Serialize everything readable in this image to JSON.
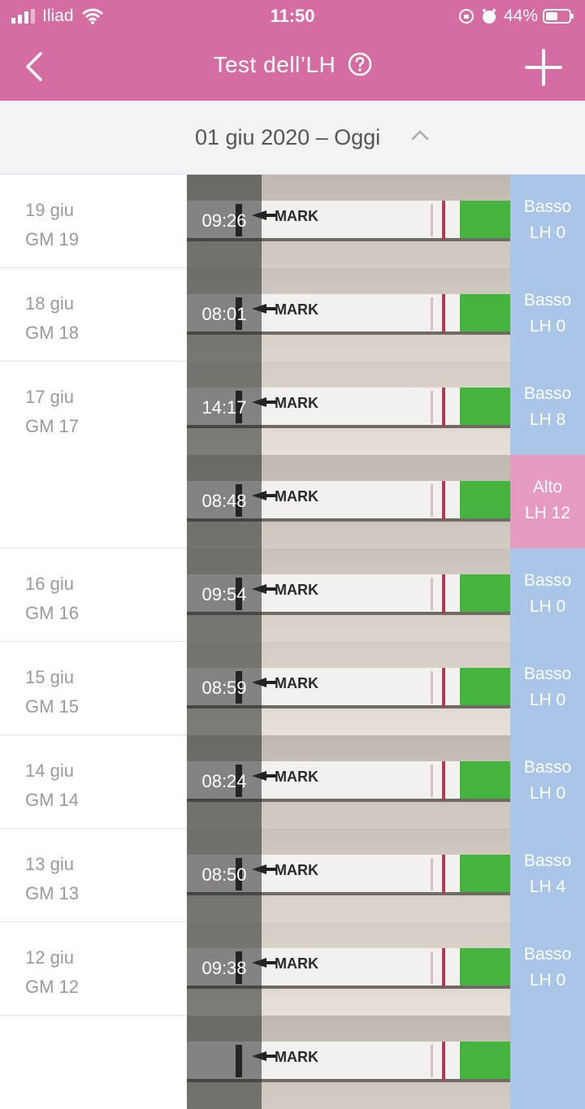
{
  "status_bar": {
    "carrier": "Iliad",
    "time": "11:50",
    "battery": "44%"
  },
  "header": {
    "title": "Test dell’LH"
  },
  "range": {
    "label": "01 giu 2020 – Oggi"
  },
  "colors": {
    "brand": "#d66da2",
    "basso": "#a9c6e9",
    "alto": "#e79ac2"
  },
  "rows": [
    {
      "date": "19 giu",
      "cycle_day": "GM 19",
      "time": "09:26",
      "level": "Basso",
      "lh": "LH 0"
    },
    {
      "date": "18 giu",
      "cycle_day": "GM 18",
      "time": "08:01",
      "level": "Basso",
      "lh": "LH 0"
    },
    {
      "date": "17 giu",
      "cycle_day": "GM 17",
      "time": "14:17",
      "level": "Basso",
      "lh": "LH 8"
    },
    {
      "date": "",
      "cycle_day": "",
      "time": "08:48",
      "level": "Alto",
      "lh": "LH 12"
    },
    {
      "date": "16 giu",
      "cycle_day": "GM 16",
      "time": "09:54",
      "level": "Basso",
      "lh": "LH 0"
    },
    {
      "date": "15 giu",
      "cycle_day": "GM 15",
      "time": "08:59",
      "level": "Basso",
      "lh": "LH 0"
    },
    {
      "date": "14 giu",
      "cycle_day": "GM 14",
      "time": "08:24",
      "level": "Basso",
      "lh": "LH 0"
    },
    {
      "date": "13 giu",
      "cycle_day": "GM 13",
      "time": "08:50",
      "level": "Basso",
      "lh": "LH 4"
    },
    {
      "date": "12 giu",
      "cycle_day": "GM 12",
      "time": "09:38",
      "level": "Basso",
      "lh": "LH 0"
    },
    {
      "date": "",
      "cycle_day": "",
      "time": "",
      "level": "",
      "lh": ""
    }
  ]
}
